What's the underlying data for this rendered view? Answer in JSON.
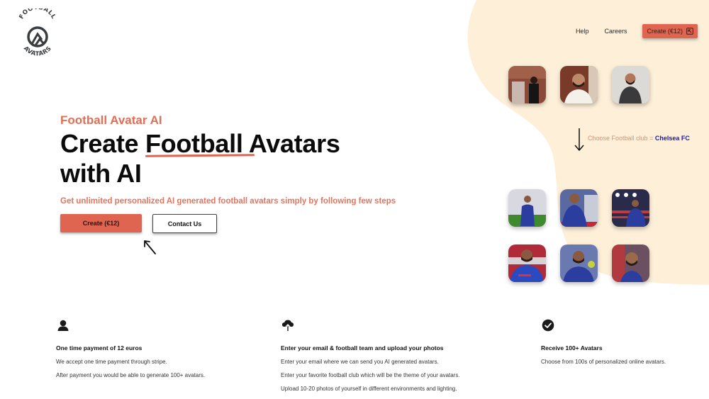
{
  "brand": {
    "logo_top": "FOOTBALL",
    "logo_bottom": "AVATARS"
  },
  "nav": {
    "links": [
      {
        "label": "Help"
      },
      {
        "label": "Careers"
      }
    ],
    "cta_label": "Create (€12)",
    "cta_icon": "external-link-icon"
  },
  "hero": {
    "eyebrow": "Football Avatar AI",
    "headline_before": "Create ",
    "headline_highlight": "Football",
    "headline_after": " Avatars",
    "headline_line2": "with AI",
    "subline": "Get unlimited personalized AI generated football avatars simply by following few steps",
    "primary_button": "Create (€12)",
    "secondary_button": "Contact Us"
  },
  "showcase": {
    "input_photos": [
      {
        "alt": "user photo 1 - standing in dark shirt"
      },
      {
        "alt": "user photo 2 - white shirt portrait"
      },
      {
        "alt": "user photo 3 - dark blazer portrait"
      }
    ],
    "club_prompt": "Choose Football club",
    "club_equals": "=",
    "club_name": "Chelsea FC",
    "output_avatars": [
      {
        "alt": "avatar - stadium pitch"
      },
      {
        "alt": "avatar - match action"
      },
      {
        "alt": "avatar - stadium lights"
      },
      {
        "alt": "avatar - red stand portrait"
      },
      {
        "alt": "avatar - crowd portrait"
      },
      {
        "alt": "avatar - close-up portrait"
      }
    ]
  },
  "features": [
    {
      "icon": "user-icon",
      "title": "One time payment of 12 euros",
      "lines": [
        "We accept one time payment through stripe.",
        "After payment you would be able to generate 100+ avatars."
      ]
    },
    {
      "icon": "cloud-upload-icon",
      "title": "Enter your email & football team and upload your photos",
      "lines": [
        "Enter your email where we can send you AI generated avatars.",
        "Enter your favorite football club which will be the theme of your avatars.",
        "Upload 10-20 photos of yourself in different environments and lighting."
      ]
    },
    {
      "icon": "check-circle-icon",
      "title": "Receive 100+ Avatars",
      "lines": [
        "Choose from 100s of personalized online avatars."
      ]
    }
  ],
  "colors": {
    "accent": "#e06550",
    "blob": "#fdefd8",
    "club_highlight": "#1a1ab8"
  }
}
